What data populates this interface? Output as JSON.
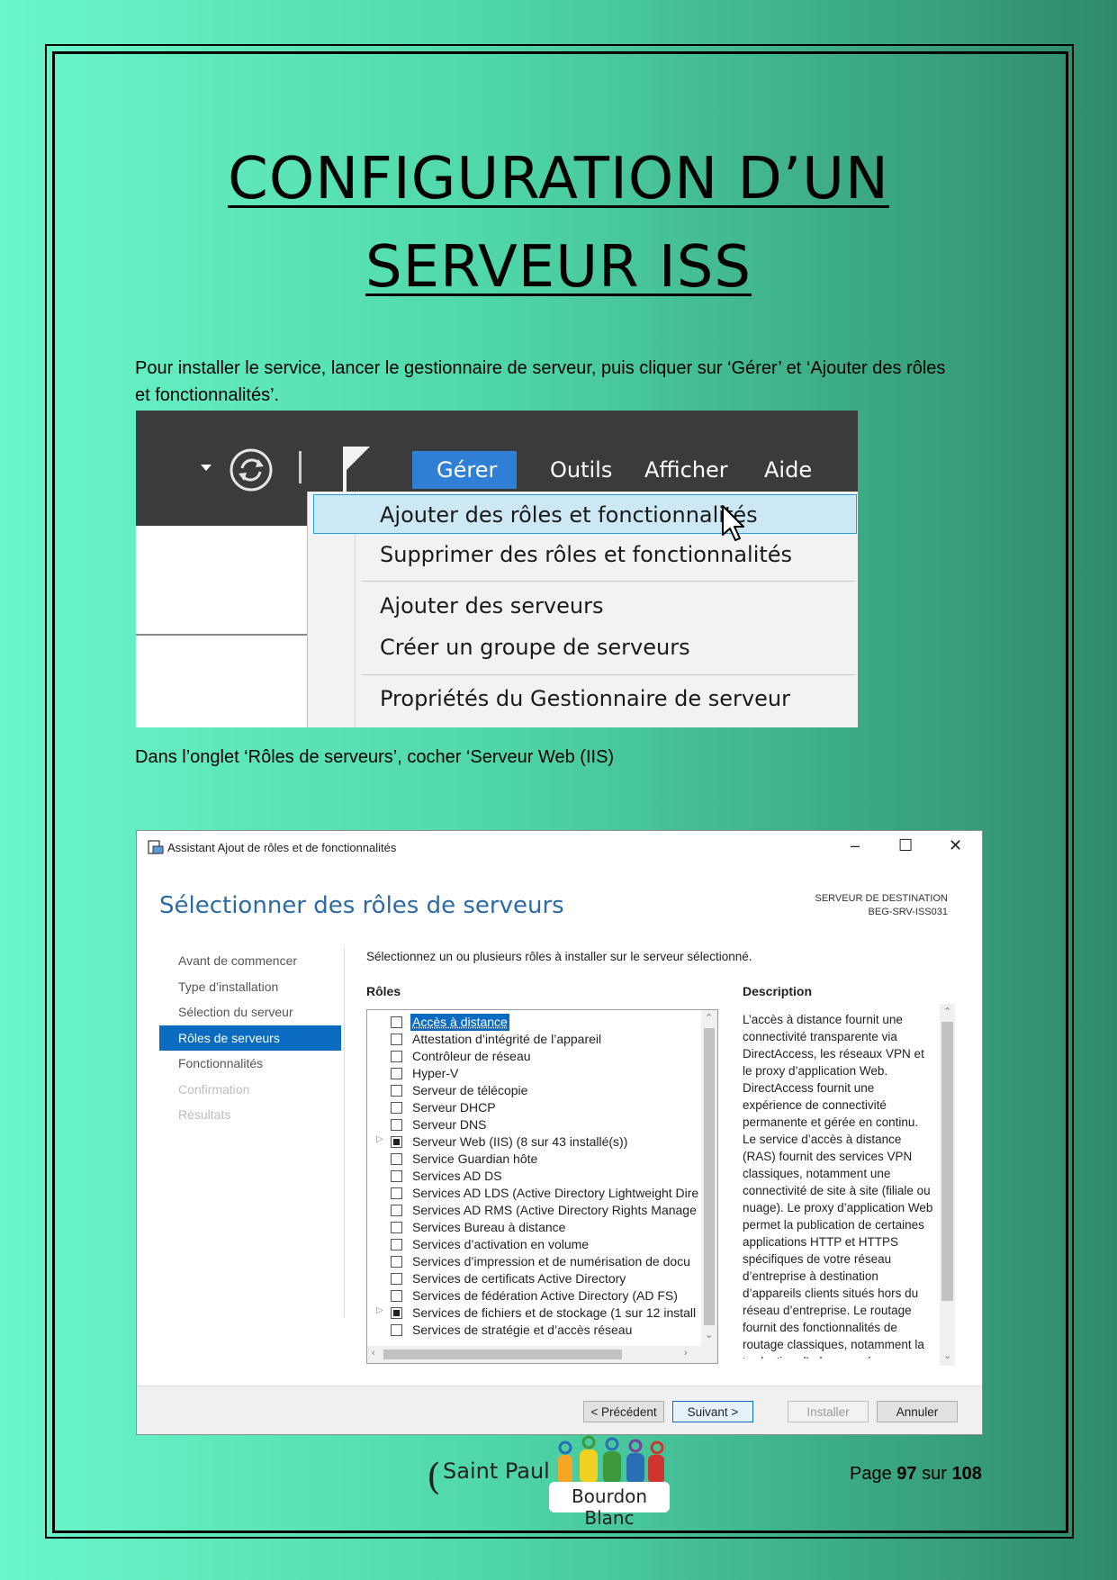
{
  "title": {
    "line1": "CONFIGURATION D’UN",
    "line2": "SERVEUR ISS"
  },
  "paragraphs": {
    "p1": "Pour installer le service, lancer le gestionnaire de serveur, puis cliquer sur ‘Gérer’ et ‘Ajouter des rôles et fonctionnalités’.",
    "p2": "Dans l’onglet ‘Rôles de serveurs’, cocher ‘Serveur Web (IIS)"
  },
  "menu_screenshot": {
    "menubar": [
      "Gérer",
      "Outils",
      "Afficher",
      "Aide"
    ],
    "items": [
      "Ajouter des rôles et fonctionnalités",
      "Supprimer des rôles et fonctionnalités",
      "Ajouter des serveurs",
      "Créer un groupe de serveurs",
      "Propriétés du Gestionnaire de serveur"
    ],
    "highlight_color": "#cce8f4",
    "active_menu_color": "#2f7fd6"
  },
  "wizard": {
    "window_title": "Assistant Ajout de rôles et de fonctionnalités",
    "controls": {
      "minimize": "–",
      "maximize": "☐",
      "close": "✕"
    },
    "heading": "Sélectionner des rôles de serveurs",
    "destination_label": "SERVEUR DE DESTINATION",
    "destination_server": "BEG-SRV-ISS031",
    "nav": [
      {
        "label": "Avant de commencer",
        "state": "normal"
      },
      {
        "label": "Type d’installation",
        "state": "normal"
      },
      {
        "label": "Sélection du serveur",
        "state": "normal"
      },
      {
        "label": "Rôles de serveurs",
        "state": "active"
      },
      {
        "label": "Fonctionnalités",
        "state": "normal"
      },
      {
        "label": "Confirmation",
        "state": "disabled"
      },
      {
        "label": "Résultats",
        "state": "disabled"
      }
    ],
    "instruction": "Sélectionnez un ou plusieurs rôles à installer sur le serveur sélectionné.",
    "roles_header": "Rôles",
    "description_header": "Description",
    "roles": [
      {
        "label": "Accès à distance",
        "checked": "none",
        "expandable": false,
        "selected": true
      },
      {
        "label": "Attestation d’intégrité de l’appareil",
        "checked": "none",
        "expandable": false
      },
      {
        "label": "Contrôleur de réseau",
        "checked": "none",
        "expandable": false
      },
      {
        "label": "Hyper-V",
        "checked": "none",
        "expandable": false
      },
      {
        "label": "Serveur de télécopie",
        "checked": "none",
        "expandable": false
      },
      {
        "label": "Serveur DHCP",
        "checked": "none",
        "expandable": false
      },
      {
        "label": "Serveur DNS",
        "checked": "none",
        "expandable": false
      },
      {
        "label": "Serveur Web (IIS) (8 sur 43 installé(s))",
        "checked": "partial",
        "expandable": true
      },
      {
        "label": "Service Guardian hôte",
        "checked": "none",
        "expandable": false
      },
      {
        "label": "Services AD DS",
        "checked": "none",
        "expandable": false
      },
      {
        "label": "Services AD LDS (Active Directory Lightweight Dire",
        "checked": "none",
        "expandable": false
      },
      {
        "label": "Services AD RMS (Active Directory Rights Manage",
        "checked": "none",
        "expandable": false
      },
      {
        "label": "Services Bureau à distance",
        "checked": "none",
        "expandable": false
      },
      {
        "label": "Services d’activation en volume",
        "checked": "none",
        "expandable": false
      },
      {
        "label": "Services d’impression et de numérisation de docu",
        "checked": "none",
        "expandable": false
      },
      {
        "label": "Services de certificats Active Directory",
        "checked": "none",
        "expandable": false
      },
      {
        "label": "Services de fédération Active Directory (AD FS)",
        "checked": "none",
        "expandable": false
      },
      {
        "label": "Services de fichiers et de stockage (1 sur 12 install",
        "checked": "partial",
        "expandable": true
      },
      {
        "label": "Services de stratégie et d’accès réseau",
        "checked": "none",
        "expandable": false
      }
    ],
    "description": "L’accès à distance fournit une connectivité transparente via DirectAccess, les réseaux VPN et le proxy d’application Web. DirectAccess fournit une expérience de connectivité permanente et gérée en continu. Le service d’accès à distance (RAS) fournit des services VPN classiques, notamment une connectivité de site à site (filiale ou nuage). Le proxy d’application Web permet la publication de certaines applications HTTP et HTTPS spécifiques de votre réseau d’entreprise à destination d’appareils clients situés hors du réseau d’entreprise. Le routage fournit des fonctionnalités de routage classiques, notamment la traduction d’adresses réseau",
    "buttons": {
      "previous": "< Précédent",
      "next": "Suivant >",
      "install": "Installer",
      "cancel": "Annuler"
    },
    "accent_color": "#0a6bc1"
  },
  "footer": {
    "logo_text1": "Saint Paul",
    "logo_text2": "Bourdon Blanc",
    "page_word": "Page",
    "page_current": "97",
    "page_of": "sur",
    "page_total": "108"
  }
}
